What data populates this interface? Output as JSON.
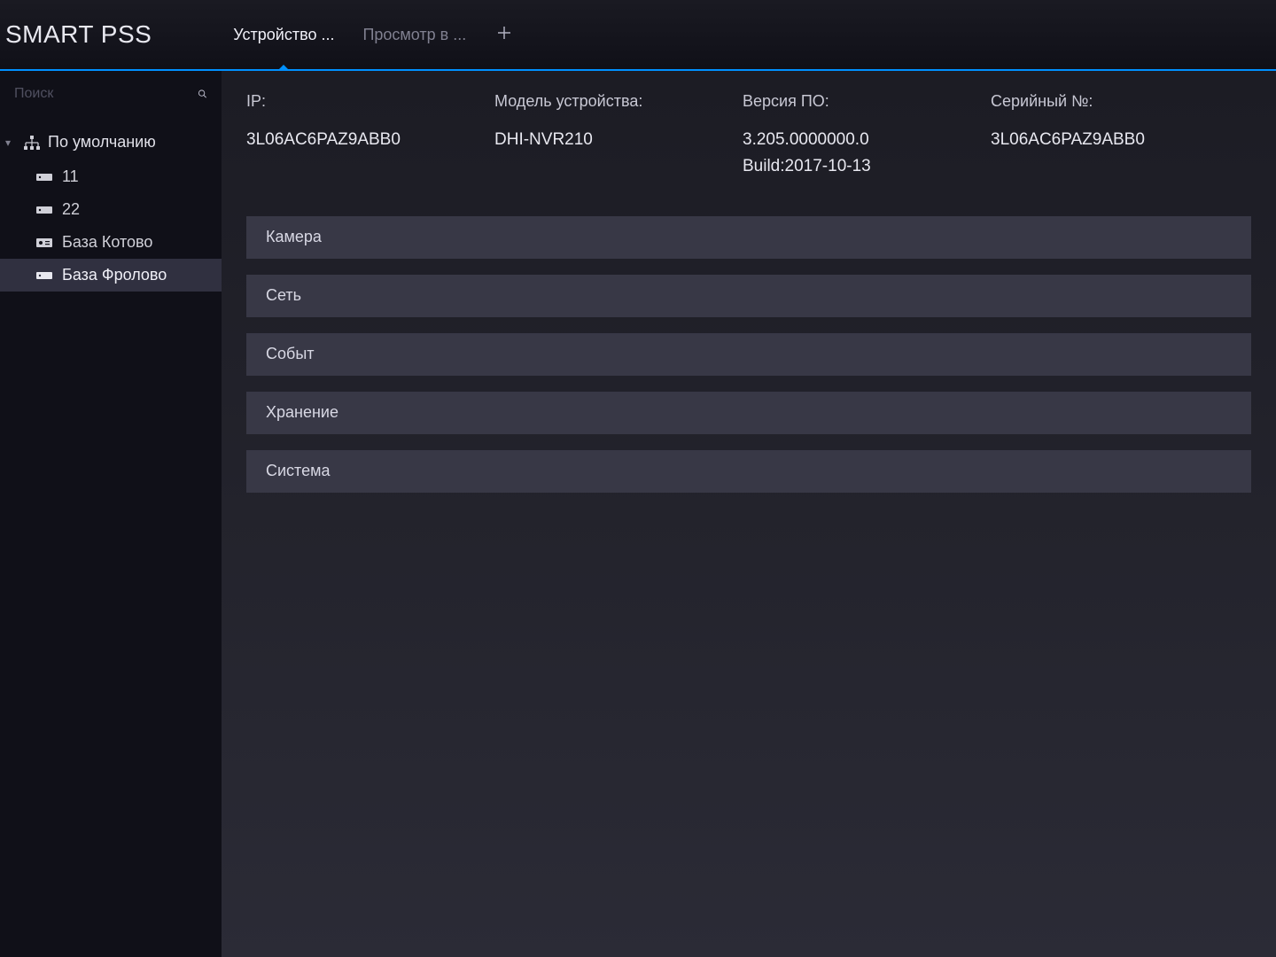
{
  "app_title": "SMART PSS",
  "tabs": {
    "active": "Устройство ...",
    "inactive": "Просмотр в ..."
  },
  "sidebar": {
    "search_placeholder": "Поиск",
    "group": "По умолчанию",
    "items": [
      {
        "label": "11"
      },
      {
        "label": "22"
      },
      {
        "label": "База Котово"
      },
      {
        "label": "База Фролово"
      }
    ]
  },
  "info": {
    "ip_label": "IP:",
    "ip_value": "3L06AC6PAZ9ABB0",
    "model_label": "Модель устройства:",
    "model_value": "DHI-NVR210",
    "sw_label": "Версия ПО:",
    "sw_value": "3.205.0000000.0",
    "build_value": "Build:2017-10-13",
    "serial_label": "Серийный №:",
    "serial_value": "3L06AC6PAZ9ABB0"
  },
  "sections": {
    "camera": "Камера",
    "network": "Сеть",
    "event": "Событ",
    "storage": "Хранение",
    "system": "Система"
  }
}
